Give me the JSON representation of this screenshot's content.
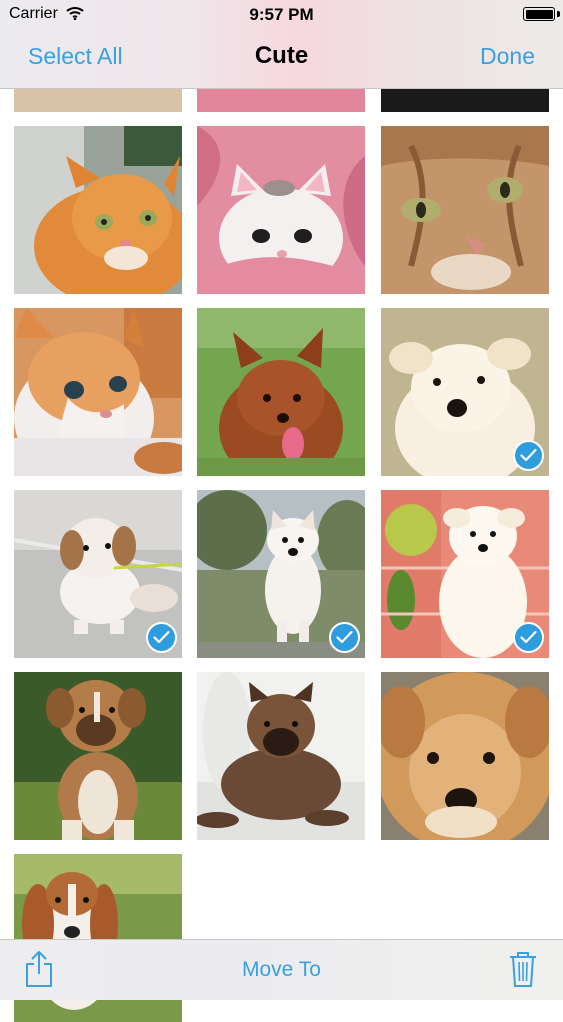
{
  "status_bar": {
    "carrier": "Carrier",
    "time": "9:57 PM"
  },
  "nav": {
    "left_button": "Select All",
    "title": "Cute",
    "right_button": "Done"
  },
  "toolbar": {
    "share_icon": "share-icon",
    "center_button": "Move To",
    "trash_icon": "trash-icon"
  },
  "accent_color": "#3aa0e0",
  "photos": [
    {
      "subject": "orange kitten",
      "selected": false
    },
    {
      "subject": "white kitten in pink blanket",
      "selected": false
    },
    {
      "subject": "tabby cat close-up",
      "selected": false
    },
    {
      "subject": "calico kitten",
      "selected": false
    },
    {
      "subject": "pomeranian on grass",
      "selected": false
    },
    {
      "subject": "white puppy",
      "selected": true
    },
    {
      "subject": "shih tzu puppy on leash",
      "selected": true
    },
    {
      "subject": "white husky puppy",
      "selected": true
    },
    {
      "subject": "white puppy with flowers",
      "selected": true
    },
    {
      "subject": "boxer puppy",
      "selected": false
    },
    {
      "subject": "brown puppy lying",
      "selected": false
    },
    {
      "subject": "fluffy tan dog face",
      "selected": false
    },
    {
      "subject": "beagle puppy",
      "selected": false
    }
  ]
}
